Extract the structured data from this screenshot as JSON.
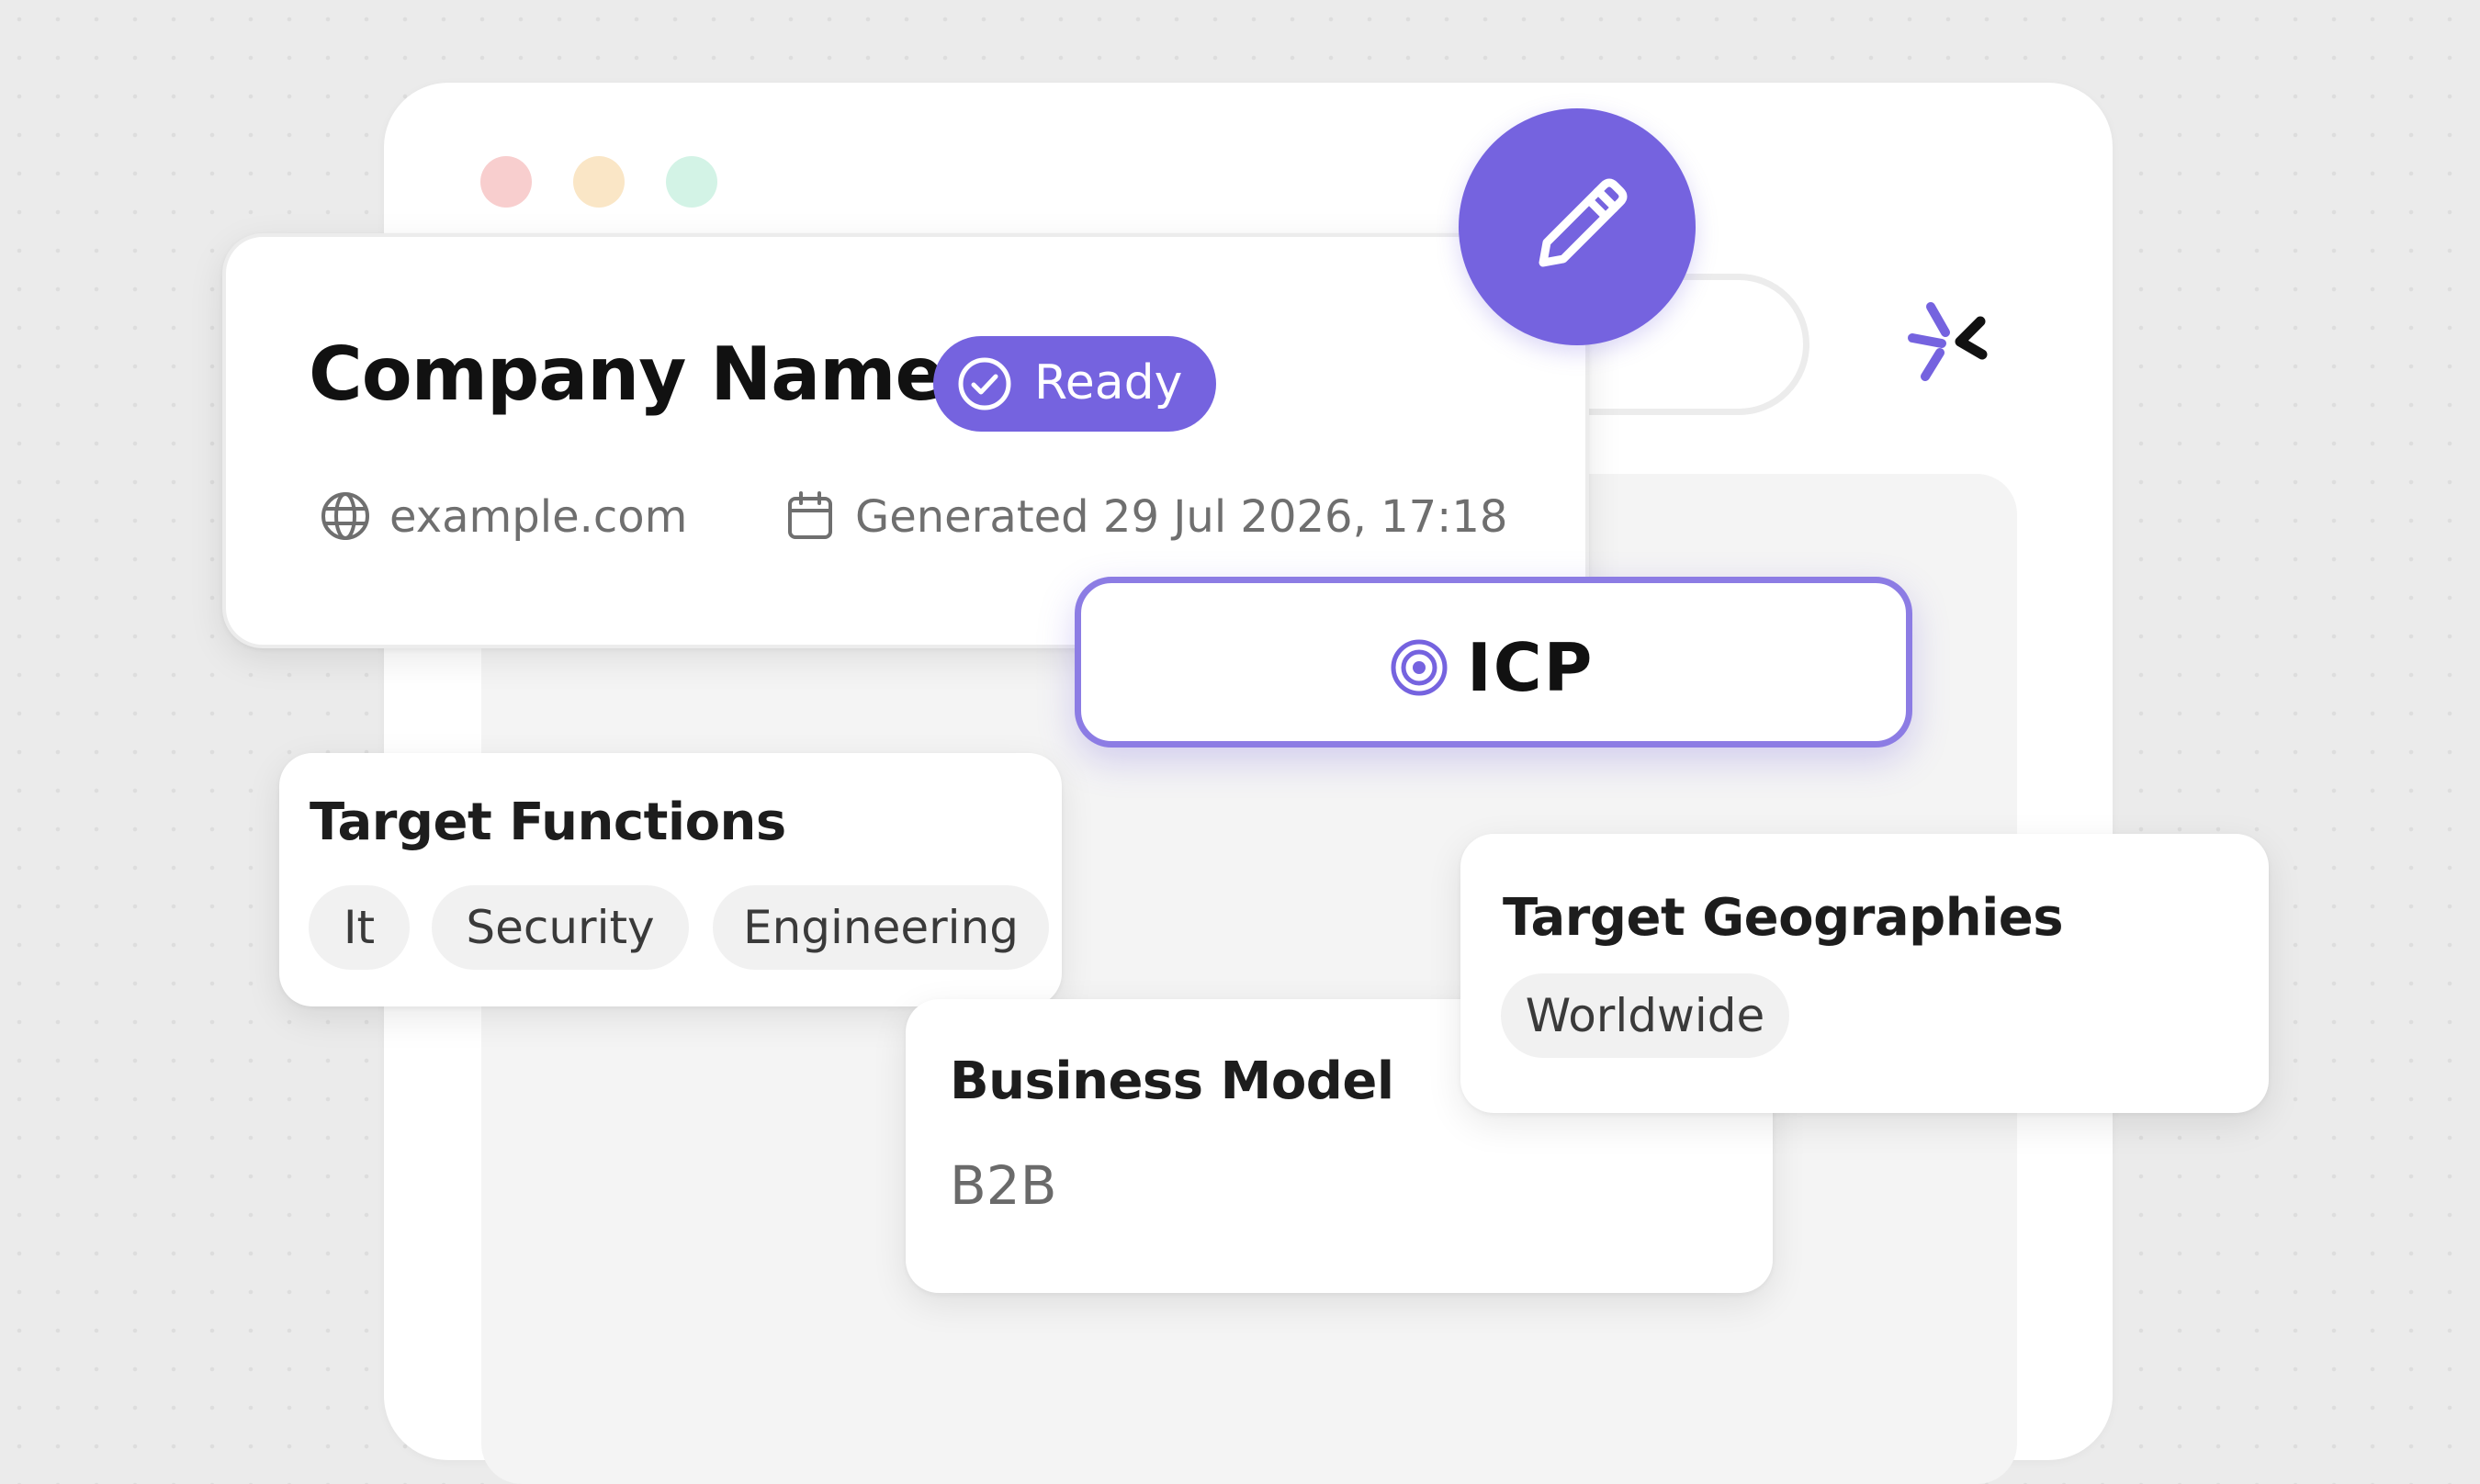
{
  "window": {
    "controls": [
      "close",
      "minimize",
      "maximize"
    ]
  },
  "header": {
    "company_name": "Company Name",
    "status": "Ready",
    "website": "example.com",
    "generated": "Generated 29 Jul 2026, 17:18"
  },
  "tab": {
    "label": "ICP"
  },
  "target_functions": {
    "title": "Target Functions",
    "chips": [
      "It",
      "Security",
      "Engineering"
    ]
  },
  "target_geographies": {
    "title": "Target Geographies",
    "chips": [
      "Worldwide"
    ]
  },
  "business_model": {
    "title": "Business Model",
    "value": "B2B"
  },
  "icons": {
    "edit": "pencil-icon",
    "status": "check-circle-icon",
    "website": "globe-icon",
    "generated": "calendar-icon",
    "tab": "target-icon",
    "logo": "brand-logo-icon"
  },
  "colors": {
    "accent": "#7563df",
    "tab_border": "#8c7ce4",
    "dot_red": "#f8cece",
    "dot_yellow": "#fae6c6",
    "dot_green": "#d3f3e6"
  }
}
